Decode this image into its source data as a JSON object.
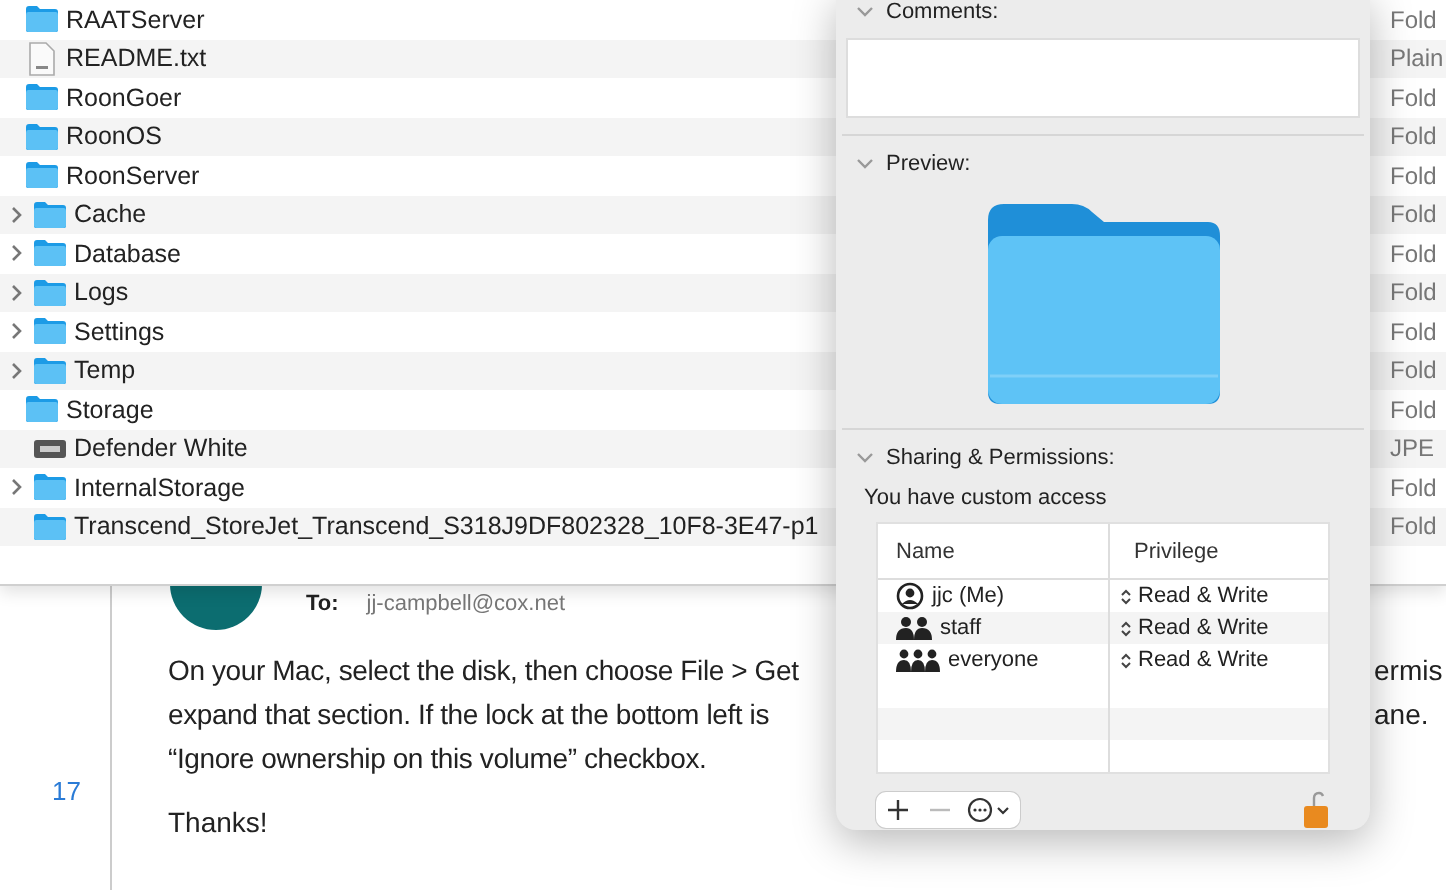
{
  "finder": {
    "rows": [
      {
        "name": "RAATServer",
        "kind": "folder",
        "disclosure": false,
        "column_2": "Fold"
      },
      {
        "name": "README.txt",
        "kind": "text",
        "disclosure": false,
        "column_2": "Plain"
      },
      {
        "name": "RoonGoer",
        "kind": "folder",
        "disclosure": false,
        "column_2": "Fold"
      },
      {
        "name": "RoonOS",
        "kind": "folder",
        "disclosure": false,
        "column_2": "Fold"
      },
      {
        "name": "RoonServer",
        "kind": "folder",
        "disclosure": false,
        "column_2": "Fold",
        "children": [
          {
            "name": "Cache",
            "kind": "folder",
            "disclosure": true,
            "column_2": "Fold"
          },
          {
            "name": "Database",
            "kind": "folder",
            "disclosure": true,
            "column_2": "Fold"
          },
          {
            "name": "Logs",
            "kind": "folder",
            "disclosure": true,
            "column_2": "Fold"
          },
          {
            "name": "Settings",
            "kind": "folder",
            "disclosure": true,
            "column_2": "Fold"
          },
          {
            "name": "Temp",
            "kind": "folder",
            "disclosure": true,
            "column_2": "Fold"
          }
        ]
      },
      {
        "name": "Storage",
        "kind": "folder",
        "disclosure": false,
        "column_2": "Fold",
        "children": [
          {
            "name": "Defender White",
            "kind": "disk",
            "disclosure": false,
            "column_2": "JPE"
          },
          {
            "name": "InternalStorage",
            "kind": "folder",
            "disclosure": true,
            "column_2": "Fold"
          },
          {
            "name": "Transcend_StoreJet_Transcend_S318J9DF802328_10F8-3E47-p1",
            "kind": "folder",
            "disclosure": false,
            "column_2": "Fold"
          }
        ]
      }
    ]
  },
  "email": {
    "to_label": "To:",
    "to": "jj-campbell@cox.net",
    "line_number": "17",
    "lines": [
      "On your Mac, select the disk, then choose File > Get",
      "expand that section. If the lock at the bottom left is",
      "“Ignore ownership on this volume” checkbox."
    ],
    "hidden_line_ends": [
      "ermis",
      "ane."
    ],
    "closing": "Thanks!"
  },
  "info": {
    "comments_label": "Comments:",
    "preview_label": "Preview:",
    "sharing_label": "Sharing & Permissions:",
    "access_note": "You have custom access",
    "columns": [
      "Name",
      "Privilege"
    ],
    "permissions": [
      {
        "kind": "user",
        "name": "jjc (Me)",
        "privilege": "Read & Write"
      },
      {
        "kind": "group",
        "name": "staff",
        "privilege": "Read & Write"
      },
      {
        "kind": "everyone",
        "name": "everyone",
        "privilege": "Read & Write"
      }
    ]
  }
}
